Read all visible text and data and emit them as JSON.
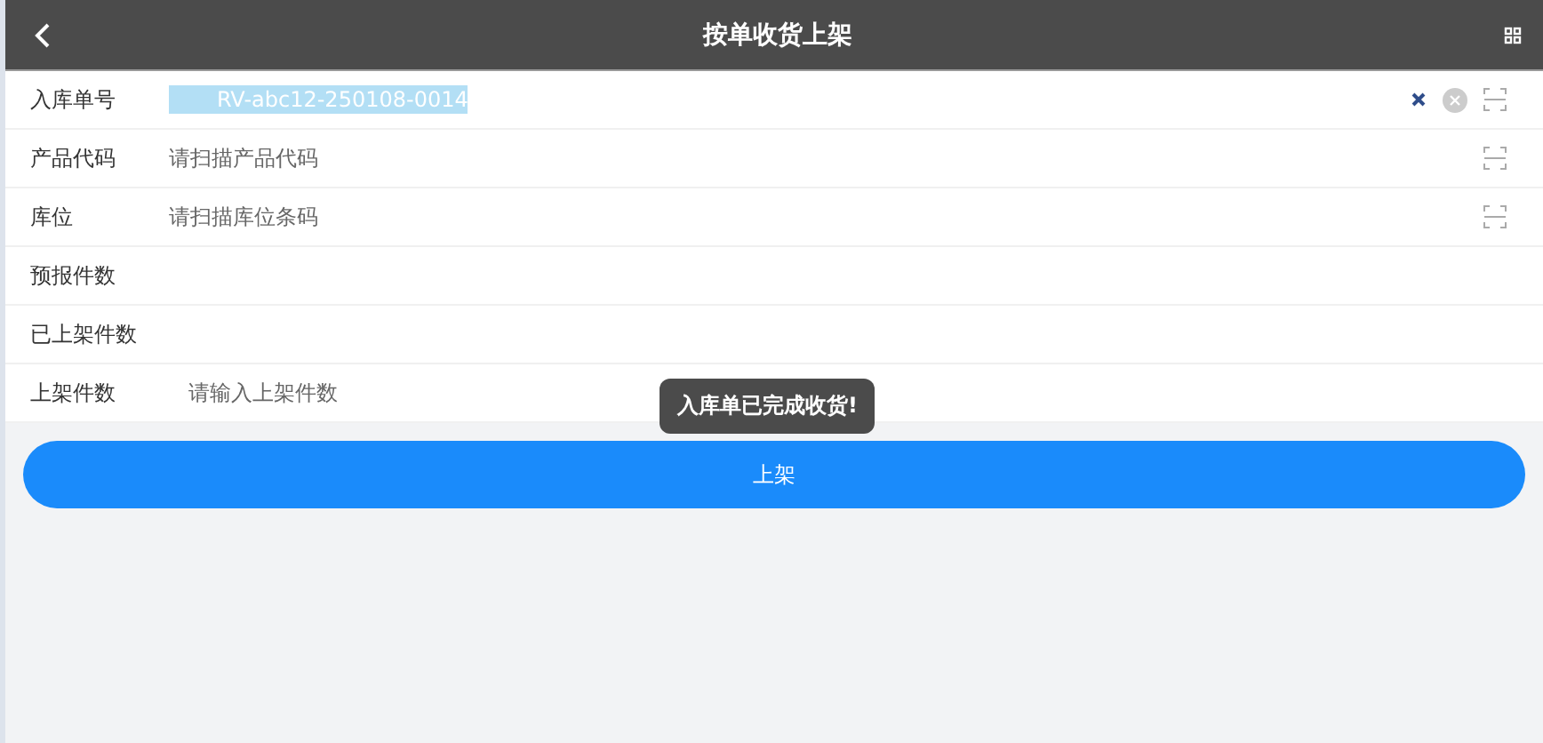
{
  "header": {
    "title": "按单收货上架"
  },
  "rows": [
    {
      "kind": "scan",
      "label": "入库单号",
      "value": "RV-abc12-250108-0014",
      "selected_text": true,
      "clear": true
    },
    {
      "kind": "scan",
      "label": "产品代码",
      "placeholder": "请扫描产品代码"
    },
    {
      "kind": "scan",
      "label": "库位",
      "placeholder": "请扫描库位条码"
    },
    {
      "kind": "info",
      "label": "预报件数"
    },
    {
      "kind": "info",
      "label": "已上架件数"
    },
    {
      "kind": "number",
      "label": "上架件数",
      "placeholder": "请输入上架件数"
    }
  ],
  "toast": "入库单已完成收货!",
  "submit": "上架"
}
